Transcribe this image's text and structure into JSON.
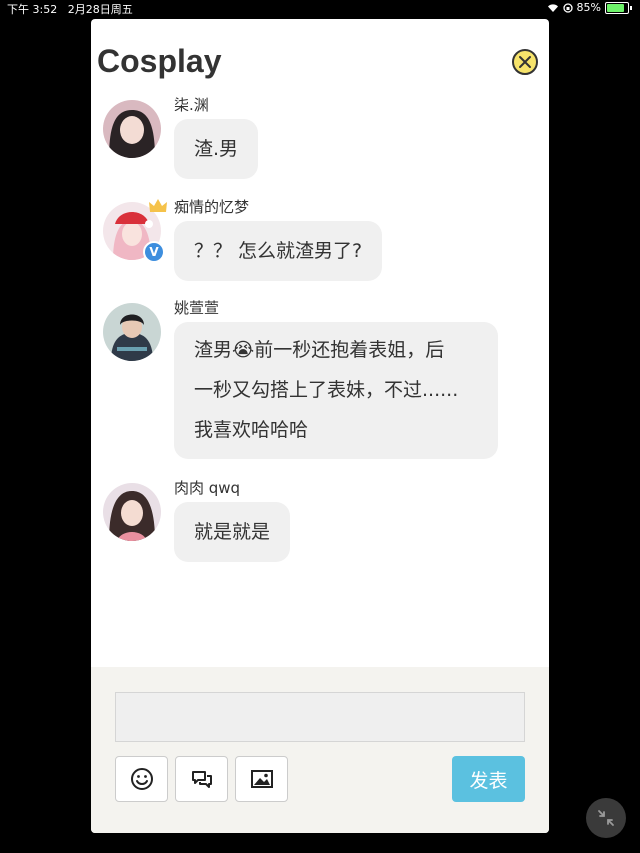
{
  "status_bar": {
    "time": "下午 3:52",
    "date": "2月28日周五",
    "battery": "85%"
  },
  "modal": {
    "title": "Cosplay",
    "comments": [
      {
        "username": "柒.渊",
        "lines": [
          "渣.男"
        ]
      },
      {
        "username": "痴情的忆梦",
        "lines": [
          "？？ 怎么就渣男了?"
        ]
      },
      {
        "username": "姚萱萱",
        "lines": [
          "渣男😭前一秒还抱着表姐，后",
          "一秒又勾搭上了表妹，不过......",
          "我喜欢哈哈哈"
        ]
      },
      {
        "username": "肉肉 qwq",
        "lines": [
          "就是就是"
        ]
      }
    ]
  },
  "composer": {
    "input_value": "",
    "submit_label": "发表"
  },
  "icons": {
    "close": "close-icon",
    "emoji": "smiley-icon",
    "quote": "speech-bubbles-icon",
    "image": "image-icon",
    "minimize": "minimize-icon"
  },
  "colors": {
    "submit": "#5bc1e0",
    "close": "#f6e36b",
    "bubble": "#f0f0f0",
    "composer_bg": "#f4f3ef"
  }
}
